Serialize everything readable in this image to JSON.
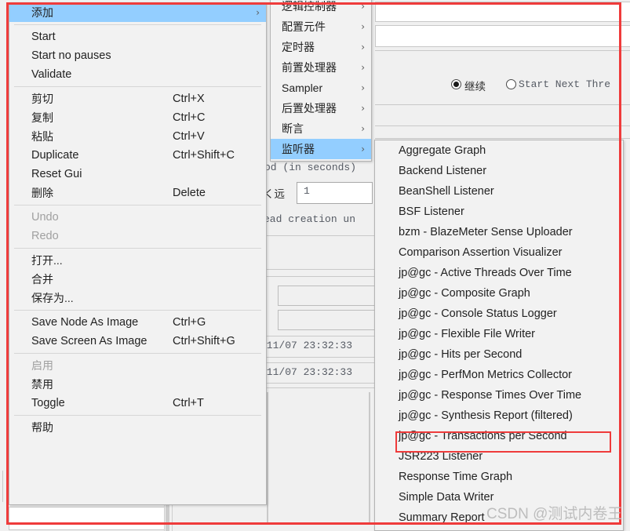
{
  "background": {
    "radio_group": {
      "option_selected": "继续",
      "option_other": "Start Next Thre",
      "selected_index": 0
    },
    "labels": {
      "period_hint": "od (in seconds)",
      "forever": "く远",
      "thread_creation": "ead creation un"
    },
    "fields": {
      "loop_count": "1"
    },
    "timestamps": [
      "/11/07  23:32:33",
      "/11/07  23:32:33"
    ]
  },
  "menu_main": {
    "items": [
      {
        "label": "添加",
        "accel": "",
        "arrow": "›",
        "selected": true,
        "disabled": false,
        "cn": true
      },
      {
        "sep": true
      },
      {
        "label": "Start",
        "accel": "",
        "arrow": "",
        "selected": false,
        "disabled": false,
        "cn": false
      },
      {
        "label": "Start no pauses",
        "accel": "",
        "arrow": "",
        "selected": false,
        "disabled": false,
        "cn": false
      },
      {
        "label": "Validate",
        "accel": "",
        "arrow": "",
        "selected": false,
        "disabled": false,
        "cn": false
      },
      {
        "sep": true
      },
      {
        "label": "剪切",
        "accel": "Ctrl+X",
        "arrow": "",
        "selected": false,
        "disabled": false,
        "cn": true
      },
      {
        "label": "复制",
        "accel": "Ctrl+C",
        "arrow": "",
        "selected": false,
        "disabled": false,
        "cn": true
      },
      {
        "label": "粘贴",
        "accel": "Ctrl+V",
        "arrow": "",
        "selected": false,
        "disabled": false,
        "cn": true
      },
      {
        "label": "Duplicate",
        "accel": "Ctrl+Shift+C",
        "arrow": "",
        "selected": false,
        "disabled": false,
        "cn": false
      },
      {
        "label": "Reset Gui",
        "accel": "",
        "arrow": "",
        "selected": false,
        "disabled": false,
        "cn": false
      },
      {
        "label": "删除",
        "accel": "Delete",
        "arrow": "",
        "selected": false,
        "disabled": false,
        "cn": true
      },
      {
        "sep": true
      },
      {
        "label": "Undo",
        "accel": "",
        "arrow": "",
        "selected": false,
        "disabled": true,
        "cn": false
      },
      {
        "label": "Redo",
        "accel": "",
        "arrow": "",
        "selected": false,
        "disabled": true,
        "cn": false
      },
      {
        "sep": true
      },
      {
        "label": "打开...",
        "accel": "",
        "arrow": "",
        "selected": false,
        "disabled": false,
        "cn": true
      },
      {
        "label": "合并",
        "accel": "",
        "arrow": "",
        "selected": false,
        "disabled": false,
        "cn": true
      },
      {
        "label": "保存为...",
        "accel": "",
        "arrow": "",
        "selected": false,
        "disabled": false,
        "cn": true
      },
      {
        "sep": true
      },
      {
        "label": "Save Node As Image",
        "accel": "Ctrl+G",
        "arrow": "",
        "selected": false,
        "disabled": false,
        "cn": false
      },
      {
        "label": "Save Screen As Image",
        "accel": "Ctrl+Shift+G",
        "arrow": "",
        "selected": false,
        "disabled": false,
        "cn": false
      },
      {
        "sep": true
      },
      {
        "label": "启用",
        "accel": "",
        "arrow": "",
        "selected": false,
        "disabled": true,
        "cn": true
      },
      {
        "label": "禁用",
        "accel": "",
        "arrow": "",
        "selected": false,
        "disabled": false,
        "cn": true
      },
      {
        "label": "Toggle",
        "accel": "Ctrl+T",
        "arrow": "",
        "selected": false,
        "disabled": false,
        "cn": false
      },
      {
        "sep": true
      },
      {
        "label": "帮助",
        "accel": "",
        "arrow": "",
        "selected": false,
        "disabled": false,
        "cn": true
      }
    ]
  },
  "menu_add": {
    "items": [
      {
        "label": "逻辑控制器",
        "arrow": "›",
        "selected": false
      },
      {
        "label": "配置元件",
        "arrow": "›",
        "selected": false
      },
      {
        "label": "定时器",
        "arrow": "›",
        "selected": false
      },
      {
        "label": "前置处理器",
        "arrow": "›",
        "selected": false
      },
      {
        "label": "Sampler",
        "arrow": "›",
        "selected": false
      },
      {
        "label": "后置处理器",
        "arrow": "›",
        "selected": false
      },
      {
        "label": "断言",
        "arrow": "›",
        "selected": false
      },
      {
        "label": "监听器",
        "arrow": "›",
        "selected": true
      }
    ]
  },
  "menu_listeners": {
    "items": [
      {
        "label": "Aggregate Graph",
        "highlighted": false
      },
      {
        "label": "Backend Listener",
        "highlighted": false
      },
      {
        "label": "BeanShell Listener",
        "highlighted": false
      },
      {
        "label": "BSF Listener",
        "highlighted": false
      },
      {
        "label": "bzm - BlazeMeter Sense Uploader",
        "highlighted": false
      },
      {
        "label": "Comparison Assertion Visualizer",
        "highlighted": false
      },
      {
        "label": "jp@gc - Active Threads Over Time",
        "highlighted": false
      },
      {
        "label": "jp@gc - Composite Graph",
        "highlighted": false
      },
      {
        "label": "jp@gc - Console Status Logger",
        "highlighted": false
      },
      {
        "label": "jp@gc - Flexible File Writer",
        "highlighted": false
      },
      {
        "label": "jp@gc - Hits per Second",
        "highlighted": false
      },
      {
        "label": "jp@gc - PerfMon Metrics Collector",
        "highlighted": false
      },
      {
        "label": "jp@gc - Response Times Over Time",
        "highlighted": false
      },
      {
        "label": "jp@gc - Synthesis Report (filtered)",
        "highlighted": false
      },
      {
        "label": "jp@gc - Transactions per Second",
        "highlighted": true
      },
      {
        "label": "JSR223 Listener",
        "highlighted": false
      },
      {
        "label": "Response Time Graph",
        "highlighted": false
      },
      {
        "label": "Simple Data Writer",
        "highlighted": false
      },
      {
        "label": "Summary Report",
        "highlighted": false
      }
    ]
  },
  "annotations": {
    "outer_box_color": "#ef3b3b",
    "highlight_box_color": "#ef3b3b",
    "watermark": "CSDN @测试内卷王"
  }
}
